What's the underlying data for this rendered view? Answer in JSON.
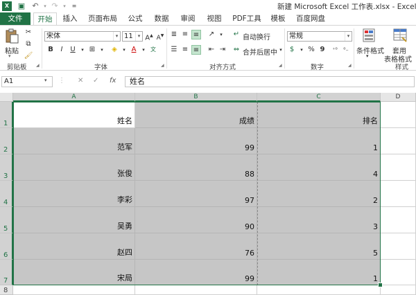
{
  "window": {
    "title": "新建 Microsoft Excel 工作表.xlsx - Excel"
  },
  "ribbon_tabs": [
    "文件",
    "开始",
    "插入",
    "页面布局",
    "公式",
    "数据",
    "审阅",
    "视图",
    "PDF工具",
    "模板",
    "百度网盘"
  ],
  "ribbon": {
    "clipboard": {
      "paste": "粘贴",
      "group": "剪贴板"
    },
    "font": {
      "name": "宋体",
      "size": "11",
      "bold": "B",
      "italic": "I",
      "underline": "U",
      "group": "字体"
    },
    "alignment": {
      "wrap": "自动换行",
      "merge": "合并后居中",
      "group": "对齐方式"
    },
    "number": {
      "format": "常规",
      "percent": "%",
      "comma": "9",
      "group": "数字"
    },
    "styles": {
      "conditional": "条件格式",
      "table1": "套用",
      "table2": "表格格式",
      "group": "样式"
    }
  },
  "formula_bar": {
    "name_box": "A1",
    "cancel": "✕",
    "enter": "✓",
    "fx": "fx",
    "content": "姓名"
  },
  "sheet": {
    "columns": [
      "A",
      "B",
      "C",
      "D"
    ],
    "row_numbers": [
      "1",
      "2",
      "3",
      "4",
      "5",
      "6",
      "7",
      "8"
    ],
    "rows": [
      [
        "姓名",
        "成绩",
        "排名"
      ],
      [
        "范军",
        "99",
        "1"
      ],
      [
        "张俊",
        "88",
        "4"
      ],
      [
        "李彩",
        "97",
        "2"
      ],
      [
        "吴勇",
        "90",
        "3"
      ],
      [
        "赵四",
        "76",
        "5"
      ],
      [
        "宋局",
        "99",
        "1"
      ]
    ]
  },
  "colors": {
    "excel_green": "#217346",
    "selection_fill": "#c6c6c6"
  }
}
